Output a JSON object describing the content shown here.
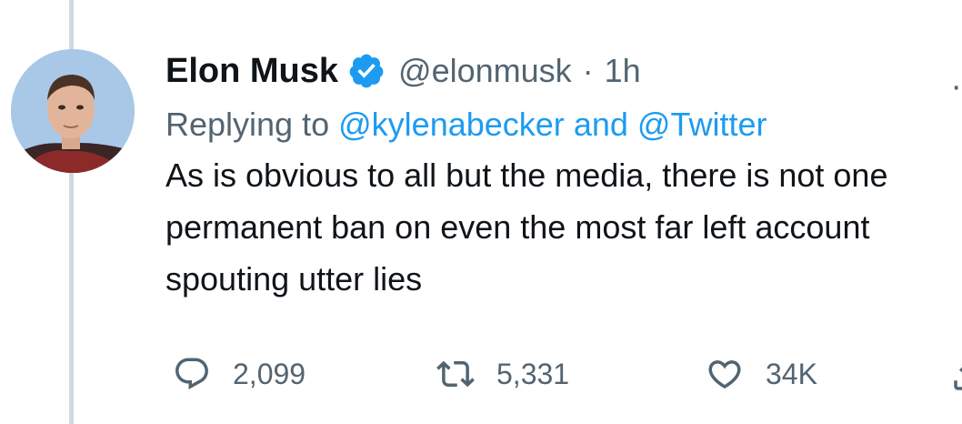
{
  "tweet": {
    "author_name": "Elon Musk",
    "handle": "@elonmusk",
    "separator": "·",
    "time": "1h",
    "reply_prefix": "Replying to",
    "reply_mention_1": "@kylenabecker",
    "reply_conjunction": "and",
    "reply_mention_2": "@Twitter",
    "text": "As is obvious to all but the media, there is not one permanent ban on even the most far left account spouting utter lies",
    "more_glyph": "·"
  },
  "actions": {
    "replies": "2,099",
    "retweets": "5,331",
    "likes": "34K"
  },
  "icons": {
    "verified": "verified-badge-icon",
    "reply": "reply-icon",
    "retweet": "retweet-icon",
    "like": "heart-icon",
    "share": "share-icon",
    "more": "more-icon"
  },
  "colors": {
    "accent": "#1d9bf0",
    "secondary_text": "#536471",
    "primary_text": "#0f1419",
    "thread_line": "#cfd9de"
  }
}
